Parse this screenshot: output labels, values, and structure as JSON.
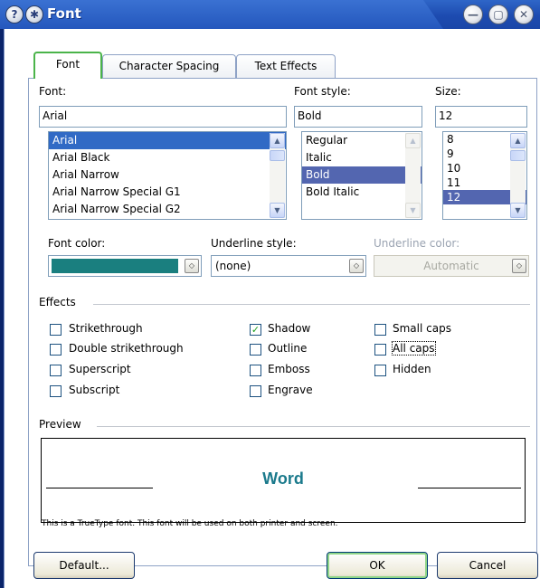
{
  "title": "Font",
  "titlebar_icons": [
    "help-icon",
    "star-icon"
  ],
  "window_controls": [
    "minimize",
    "maximize",
    "close"
  ],
  "tabs": [
    {
      "label": "Font",
      "active": true
    },
    {
      "label": "Character Spacing",
      "active": false
    },
    {
      "label": "Text Effects",
      "active": false
    }
  ],
  "font": {
    "label": "Font:",
    "value": "Arial",
    "items": [
      "Arial",
      "Arial Black",
      "Arial Narrow",
      "Arial Narrow Special G1",
      "Arial Narrow Special G2"
    ],
    "selected": "Arial"
  },
  "font_style": {
    "label": "Font style:",
    "value": "Bold",
    "items": [
      "Regular",
      "Italic",
      "Bold",
      "Bold Italic"
    ],
    "selected": "Bold"
  },
  "size": {
    "label": "Size:",
    "value": "12",
    "items": [
      "8",
      "9",
      "10",
      "11",
      "12"
    ],
    "selected": "12"
  },
  "font_color": {
    "label": "Font color:",
    "value_color": "#1a7f7f"
  },
  "underline_style": {
    "label": "Underline style:",
    "value": "(none)"
  },
  "underline_color": {
    "label": "Underline color:",
    "value": "Automatic",
    "disabled": true
  },
  "effects": {
    "label": "Effects",
    "items": [
      {
        "label": "Strikethrough",
        "checked": false
      },
      {
        "label": "Double strikethrough",
        "checked": false
      },
      {
        "label": "Superscript",
        "checked": false
      },
      {
        "label": "Subscript",
        "checked": false
      },
      {
        "label": "Shadow",
        "checked": true
      },
      {
        "label": "Outline",
        "checked": false
      },
      {
        "label": "Emboss",
        "checked": false
      },
      {
        "label": "Engrave",
        "checked": false
      },
      {
        "label": "Small caps",
        "checked": false
      },
      {
        "label": "All caps",
        "checked": false
      },
      {
        "label": "Hidden",
        "checked": false
      }
    ]
  },
  "preview": {
    "label": "Preview",
    "text": "Word",
    "note": "This is a TrueType font. This font will be used on both printer and screen."
  },
  "buttons": {
    "default": "Default...",
    "ok": "OK",
    "cancel": "Cancel"
  },
  "colors": {
    "title_bar": "#2457bd",
    "selection": "#316ac5",
    "font_color_swatch": "#1a7f7f",
    "preview_text": "#1b7a8c",
    "checkmark": "#21a121"
  }
}
